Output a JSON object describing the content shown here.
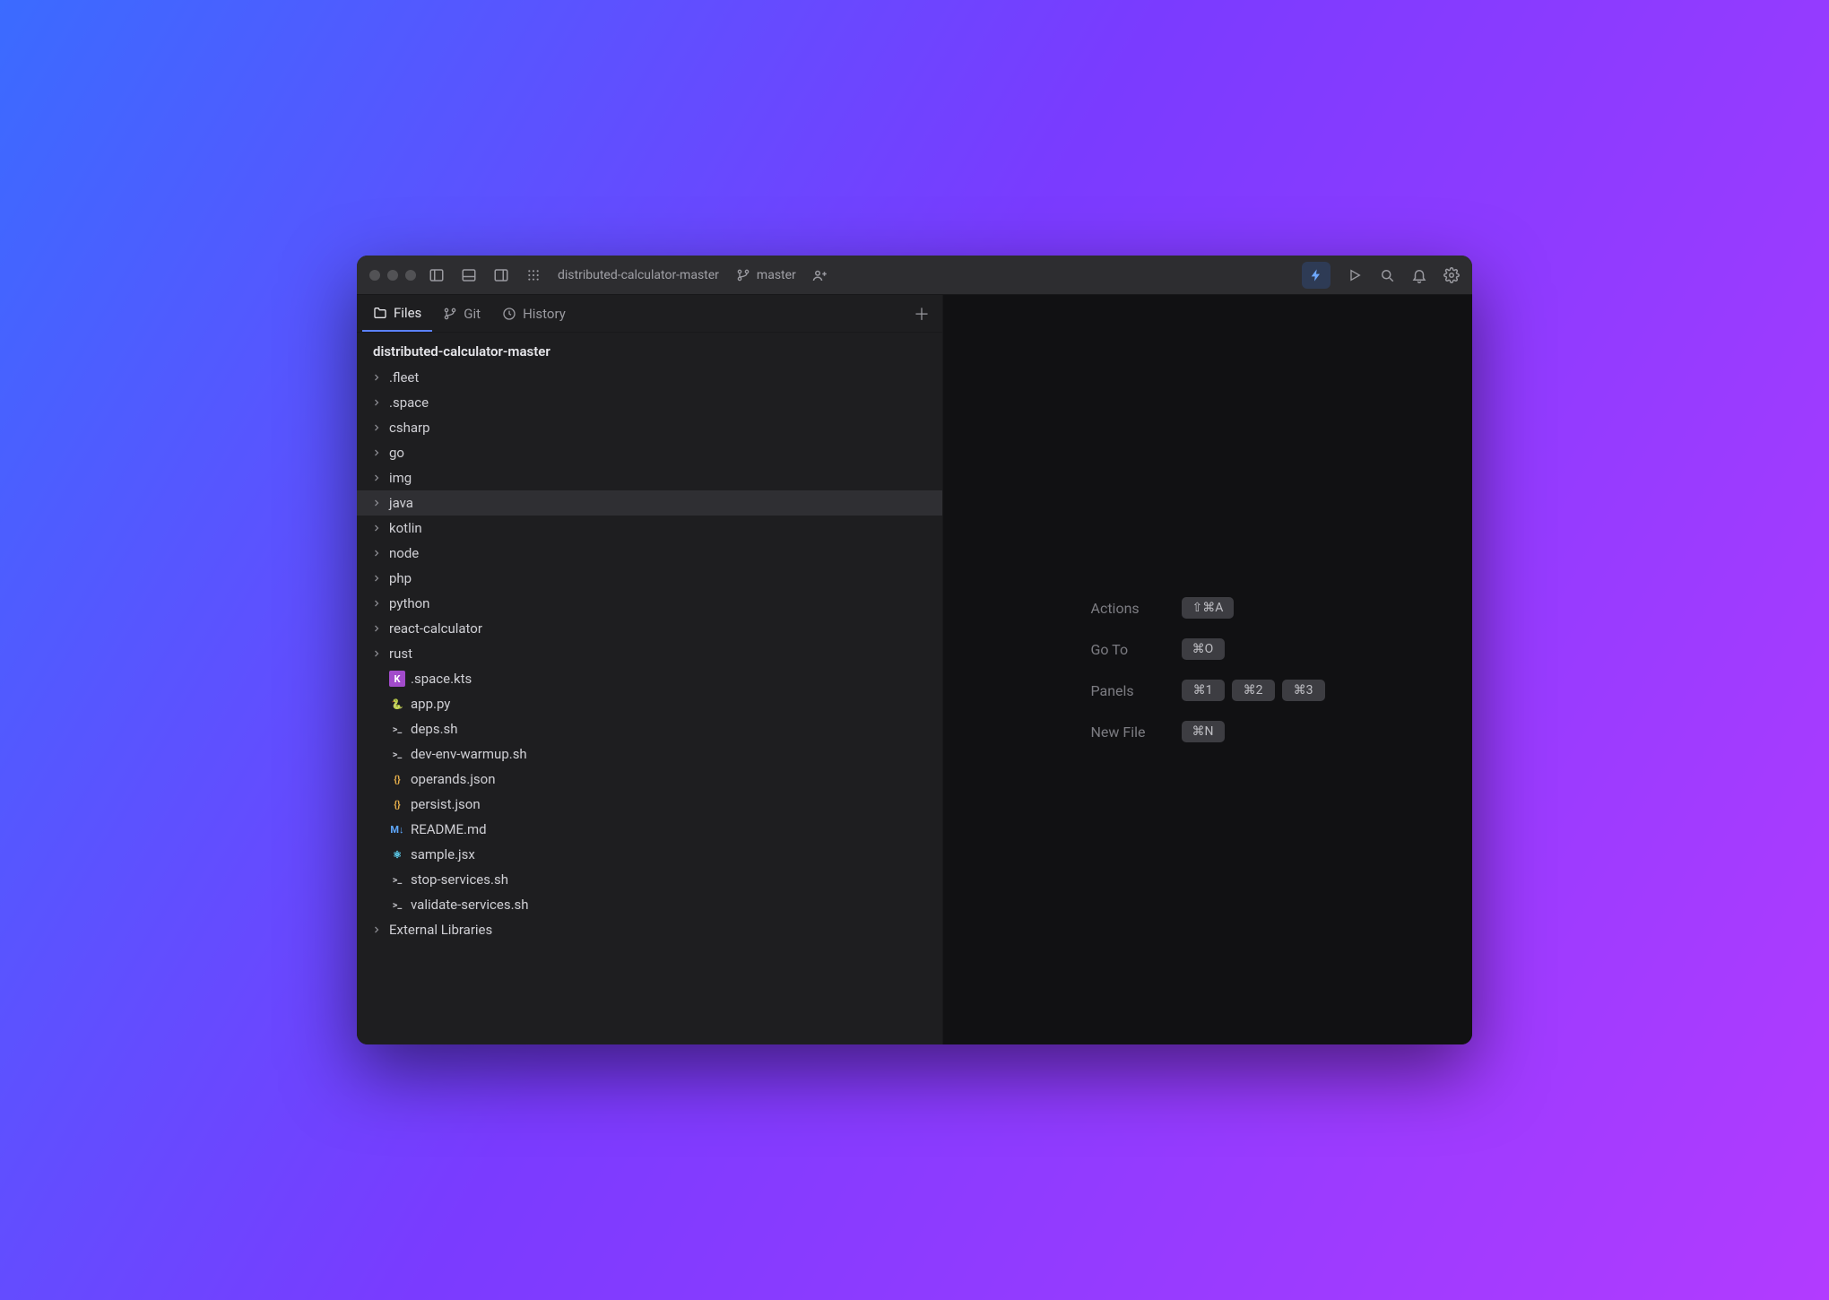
{
  "titlebar": {
    "project_name": "distributed-calculator-master",
    "branch_name": "master"
  },
  "sidebar": {
    "tabs": [
      {
        "id": "files",
        "label": "Files",
        "active": true
      },
      {
        "id": "git",
        "label": "Git",
        "active": false
      },
      {
        "id": "history",
        "label": "History",
        "active": false
      }
    ],
    "root_label": "distributed-calculator-master",
    "tree": [
      {
        "kind": "folder",
        "label": ".fleet"
      },
      {
        "kind": "folder",
        "label": ".space"
      },
      {
        "kind": "folder",
        "label": "csharp"
      },
      {
        "kind": "folder",
        "label": "go"
      },
      {
        "kind": "folder",
        "label": "img"
      },
      {
        "kind": "folder",
        "label": "java",
        "hovered": true
      },
      {
        "kind": "folder",
        "label": "kotlin"
      },
      {
        "kind": "folder",
        "label": "node"
      },
      {
        "kind": "folder",
        "label": "php"
      },
      {
        "kind": "folder",
        "label": "python"
      },
      {
        "kind": "folder",
        "label": "react-calculator"
      },
      {
        "kind": "folder",
        "label": "rust"
      },
      {
        "kind": "file",
        "label": ".space.kts",
        "ftype": "kt"
      },
      {
        "kind": "file",
        "label": "app.py",
        "ftype": "py"
      },
      {
        "kind": "file",
        "label": "deps.sh",
        "ftype": "sh"
      },
      {
        "kind": "file",
        "label": "dev-env-warmup.sh",
        "ftype": "sh"
      },
      {
        "kind": "file",
        "label": "operands.json",
        "ftype": "json"
      },
      {
        "kind": "file",
        "label": "persist.json",
        "ftype": "json"
      },
      {
        "kind": "file",
        "label": "README.md",
        "ftype": "md"
      },
      {
        "kind": "file",
        "label": "sample.jsx",
        "ftype": "jsx"
      },
      {
        "kind": "file",
        "label": "stop-services.sh",
        "ftype": "sh"
      },
      {
        "kind": "file",
        "label": "validate-services.sh",
        "ftype": "sh"
      },
      {
        "kind": "folder",
        "label": "External Libraries"
      }
    ]
  },
  "shortcuts": [
    {
      "label": "Actions",
      "keys": [
        "⇧⌘A"
      ]
    },
    {
      "label": "Go To",
      "keys": [
        "⌘O"
      ]
    },
    {
      "label": "Panels",
      "keys": [
        "⌘1",
        "⌘2",
        "⌘3"
      ]
    },
    {
      "label": "New File",
      "keys": [
        "⌘N"
      ]
    }
  ],
  "icons": {
    "kt": "K",
    "py": "🐍",
    "sh": ">_",
    "json": "{}",
    "md": "M↓",
    "jsx": "⚛"
  }
}
